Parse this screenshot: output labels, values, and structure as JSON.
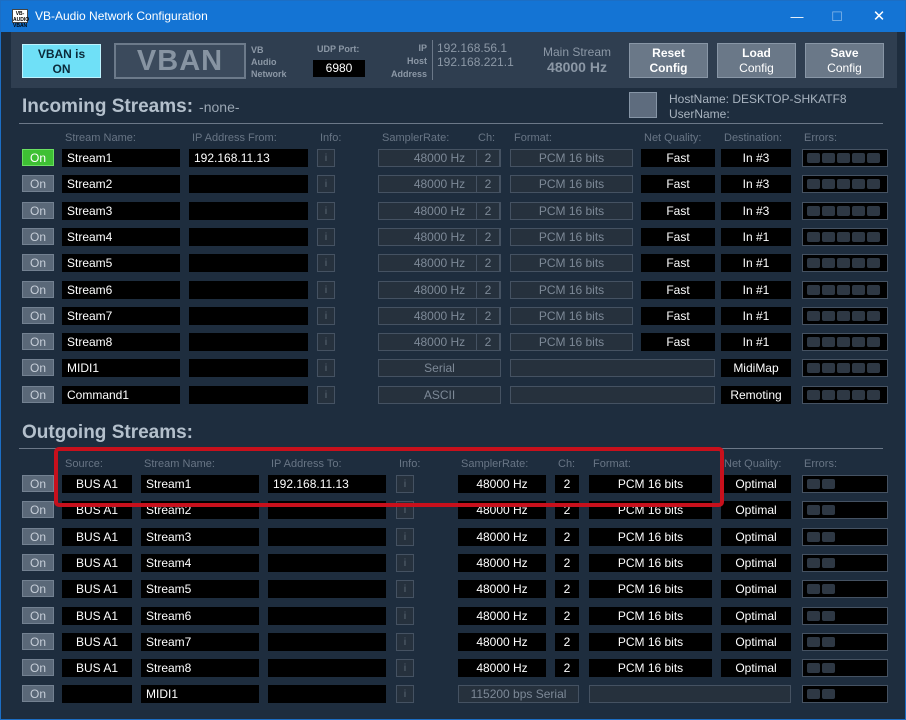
{
  "window": {
    "title": "VB-Audio Network Configuration",
    "icon_text": "VB-AUDIO VBAN",
    "min_label": "—",
    "max_label": "☐",
    "close_label": "✕"
  },
  "topbar": {
    "vban_status": "VBAN is ON",
    "logo_text": "VBAN",
    "vb_sub": [
      "VB",
      "Audio",
      "Network"
    ],
    "udp_label": "UDP Port:",
    "udp_port": "6980",
    "ip_labels": [
      "IP",
      "Host",
      "Address"
    ],
    "ip_addresses": [
      "192.168.56.1",
      "192.168.221.1"
    ],
    "main_stream_label": "Main Stream",
    "main_stream_rate": "48000 Hz",
    "buttons": [
      {
        "line1": "Reset",
        "line2": "Config"
      },
      {
        "line1": "Load",
        "line2": "Config"
      },
      {
        "line1": "Save",
        "line2": "Config"
      }
    ]
  },
  "host": {
    "hostname": "HostName: DESKTOP-SHKATF8",
    "username": "UserName:"
  },
  "incoming": {
    "title": "Incoming Streams:",
    "subtitle": "-none-",
    "headers": [
      "Stream Name:",
      "IP Address From:",
      "Info:",
      "SamplerRate:",
      "Ch:",
      "Format:",
      "Net Quality:",
      "Destination:",
      "Errors:"
    ],
    "rows": [
      {
        "on": "On",
        "active": true,
        "name": "Stream1",
        "ip": "192.168.11.13",
        "info": "i",
        "rate": "48000 Hz",
        "ch": "2",
        "format": "PCM 16 bits",
        "quality": "Fast",
        "dest": "In #3"
      },
      {
        "on": "On",
        "active": false,
        "name": "Stream2",
        "ip": "",
        "info": "i",
        "rate": "48000 Hz",
        "ch": "2",
        "format": "PCM 16 bits",
        "quality": "Fast",
        "dest": "In #3"
      },
      {
        "on": "On",
        "active": false,
        "name": "Stream3",
        "ip": "",
        "info": "i",
        "rate": "48000 Hz",
        "ch": "2",
        "format": "PCM 16 bits",
        "quality": "Fast",
        "dest": "In #3"
      },
      {
        "on": "On",
        "active": false,
        "name": "Stream4",
        "ip": "",
        "info": "i",
        "rate": "48000 Hz",
        "ch": "2",
        "format": "PCM 16 bits",
        "quality": "Fast",
        "dest": "In #1"
      },
      {
        "on": "On",
        "active": false,
        "name": "Stream5",
        "ip": "",
        "info": "i",
        "rate": "48000 Hz",
        "ch": "2",
        "format": "PCM 16 bits",
        "quality": "Fast",
        "dest": "In #1"
      },
      {
        "on": "On",
        "active": false,
        "name": "Stream6",
        "ip": "",
        "info": "i",
        "rate": "48000 Hz",
        "ch": "2",
        "format": "PCM 16 bits",
        "quality": "Fast",
        "dest": "In #1"
      },
      {
        "on": "On",
        "active": false,
        "name": "Stream7",
        "ip": "",
        "info": "i",
        "rate": "48000 Hz",
        "ch": "2",
        "format": "PCM 16 bits",
        "quality": "Fast",
        "dest": "In #1"
      },
      {
        "on": "On",
        "active": false,
        "name": "Stream8",
        "ip": "",
        "info": "i",
        "rate": "48000 Hz",
        "ch": "2",
        "format": "PCM 16 bits",
        "quality": "Fast",
        "dest": "In #1"
      }
    ],
    "special_rows": [
      {
        "on": "On",
        "name": "MIDI1",
        "ip": "",
        "info": "i",
        "mode": "Serial",
        "dest": "MidiMap"
      },
      {
        "on": "On",
        "name": "Command1",
        "ip": "",
        "info": "i",
        "mode": "ASCII",
        "dest": "Remoting"
      }
    ]
  },
  "outgoing": {
    "title": "Outgoing Streams:",
    "headers": [
      "Source:",
      "Stream Name:",
      "IP Address To:",
      "Info:",
      "SamplerRate:",
      "Ch:",
      "Format:",
      "Net Quality:",
      "Errors:"
    ],
    "rows": [
      {
        "on": "On",
        "source": "BUS A1",
        "name": "Stream1",
        "ip": "192.168.11.13",
        "info": "i",
        "rate": "48000 Hz",
        "ch": "2",
        "format": "PCM 16 bits",
        "quality": "Optimal"
      },
      {
        "on": "On",
        "source": "BUS A1",
        "name": "Stream2",
        "ip": "",
        "info": "i",
        "rate": "48000 Hz",
        "ch": "2",
        "format": "PCM 16 bits",
        "quality": "Optimal"
      },
      {
        "on": "On",
        "source": "BUS A1",
        "name": "Stream3",
        "ip": "",
        "info": "i",
        "rate": "48000 Hz",
        "ch": "2",
        "format": "PCM 16 bits",
        "quality": "Optimal"
      },
      {
        "on": "On",
        "source": "BUS A1",
        "name": "Stream4",
        "ip": "",
        "info": "i",
        "rate": "48000 Hz",
        "ch": "2",
        "format": "PCM 16 bits",
        "quality": "Optimal"
      },
      {
        "on": "On",
        "source": "BUS A1",
        "name": "Stream5",
        "ip": "",
        "info": "i",
        "rate": "48000 Hz",
        "ch": "2",
        "format": "PCM 16 bits",
        "quality": "Optimal"
      },
      {
        "on": "On",
        "source": "BUS A1",
        "name": "Stream6",
        "ip": "",
        "info": "i",
        "rate": "48000 Hz",
        "ch": "2",
        "format": "PCM 16 bits",
        "quality": "Optimal"
      },
      {
        "on": "On",
        "source": "BUS A1",
        "name": "Stream7",
        "ip": "",
        "info": "i",
        "rate": "48000 Hz",
        "ch": "2",
        "format": "PCM 16 bits",
        "quality": "Optimal"
      },
      {
        "on": "On",
        "source": "BUS A1",
        "name": "Stream8",
        "ip": "",
        "info": "i",
        "rate": "48000 Hz",
        "ch": "2",
        "format": "PCM 16 bits",
        "quality": "Optimal"
      }
    ],
    "midi_row": {
      "on": "On",
      "source": "",
      "name": "MIDI1",
      "ip": "",
      "info": "i",
      "rate": "115200 bps Serial"
    }
  },
  "colors": {
    "titlebar": "#1474d4",
    "background": "#1e2d3e",
    "vban_on": "#6fe0f7",
    "active_green": "#3ec034",
    "highlight_red": "#c8101c"
  }
}
